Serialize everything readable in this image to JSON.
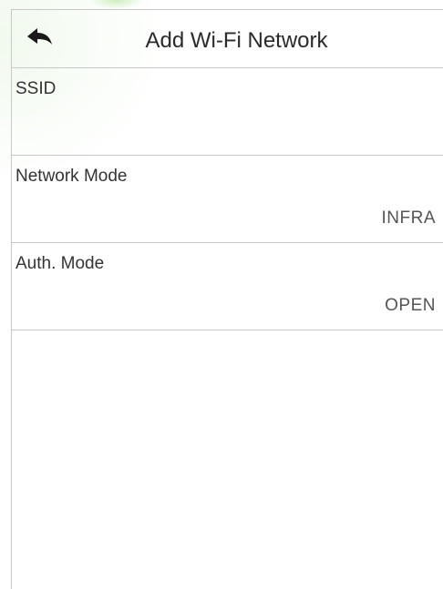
{
  "header": {
    "title": "Add Wi-Fi Network",
    "back_icon": "back-arrow-icon"
  },
  "settings": [
    {
      "label": "SSID",
      "value": ""
    },
    {
      "label": "Network Mode",
      "value": "INFRA"
    },
    {
      "label": "Auth. Mode",
      "value": "OPEN"
    }
  ],
  "colors": {
    "divider": "#c8c8c8",
    "text": "#333333",
    "watermark": "#78c85a"
  }
}
